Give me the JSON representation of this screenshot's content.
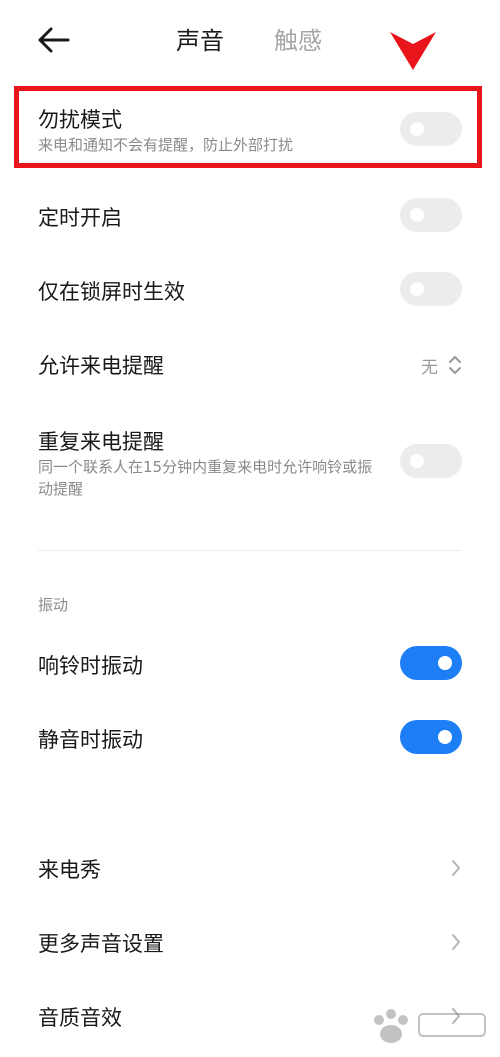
{
  "header": {
    "tab_sound": "声音",
    "tab_haptic": "触感"
  },
  "dnd": {
    "title": "勿扰模式",
    "subtitle": "来电和通知不会有提醒，防止外部打扰",
    "on": false
  },
  "rows": [
    {
      "label": "定时开启",
      "on": false
    },
    {
      "label": "仅在锁屏时生效",
      "on": false
    }
  ],
  "allow_calls": {
    "label": "允许来电提醒",
    "value": "无"
  },
  "repeat_calls": {
    "label": "重复来电提醒",
    "subtitle": "同一个联系人在15分钟内重复来电时允许响铃或振动提醒",
    "on": false
  },
  "vibration": {
    "section": "振动",
    "ring": {
      "label": "响铃时振动",
      "on": true
    },
    "silent": {
      "label": "静音时振动",
      "on": true
    }
  },
  "links": [
    {
      "label": "来电秀"
    },
    {
      "label": "更多声音设置"
    },
    {
      "label": "音质音效"
    }
  ],
  "colors": {
    "accent": "#1e7ef5",
    "annotation": "#e8151b"
  }
}
